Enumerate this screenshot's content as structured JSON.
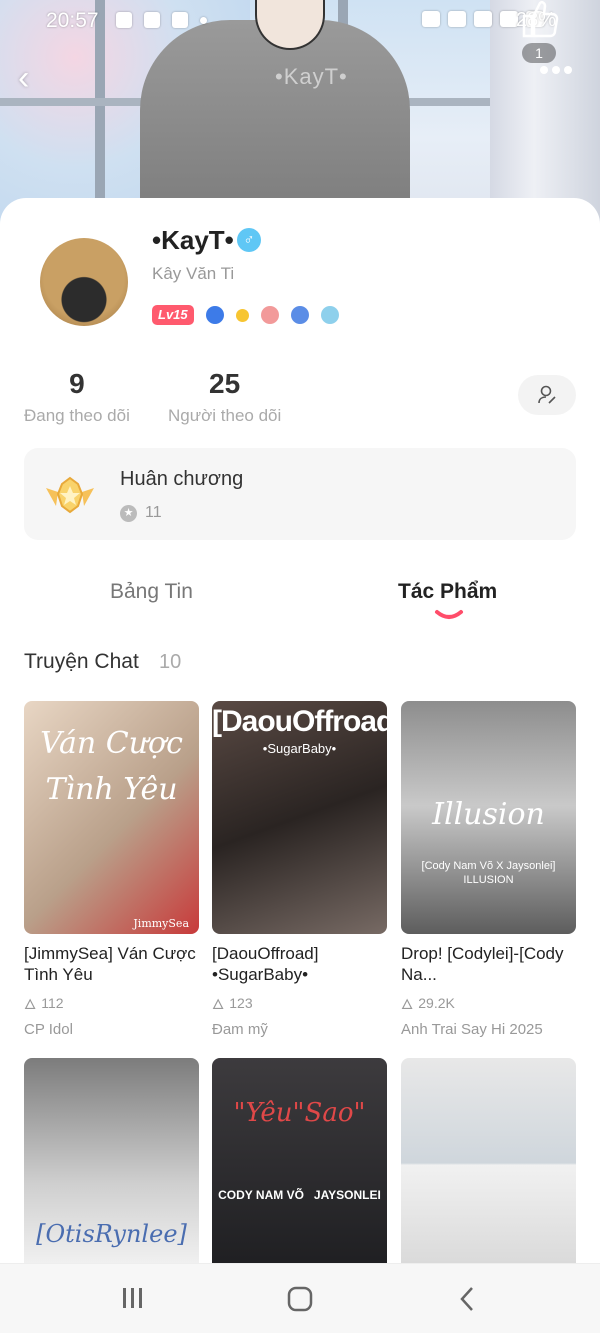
{
  "status_bar": {
    "time": "20:57",
    "battery": "28%"
  },
  "hero": {
    "shirt_text": "•KayT•",
    "like_count": "1"
  },
  "profile": {
    "nickname": "•KayT•",
    "gender_symbol": "♂",
    "real_name": "Kây Văn Ti",
    "level": "Lv15"
  },
  "stats": {
    "following_count": "9",
    "following_label": "Đang theo dõi",
    "followers_count": "25",
    "followers_label": "Người theo dõi"
  },
  "medals": {
    "title": "Huân chương",
    "count": "11"
  },
  "tabs": {
    "feed": "Bảng Tin",
    "works": "Tác Phẩm"
  },
  "section": {
    "title": "Truyện Chat",
    "count": "10"
  },
  "stories": [
    {
      "cover_text": "Ván Cược Tình Yêu",
      "cover_sub": "JimmySea",
      "title": "[JimmySea] Ván Cược Tình Yêu",
      "views": "112",
      "category": "CP Idol"
    },
    {
      "cover_text": "[DaouOffroad]",
      "cover_sub": "•SugarBaby•",
      "title": "[DaouOffroad] •SugarBaby•",
      "views": "123",
      "category": "Đam mỹ"
    },
    {
      "cover_text": "Illusion",
      "cover_sub": "[Cody Nam Võ X Jaysonlei] ILLUSION",
      "title": "Drop! [Codylei]-[Cody Na...",
      "views": "29.2K",
      "category": "Anh Trai Say Hi 2025"
    },
    {
      "cover_text": "[OtisRynlee]",
      "cover_sub": "",
      "title": "",
      "views": "",
      "category": ""
    },
    {
      "cover_text": "\"Yêu\"Sao\"",
      "cover_sub": "CODY NAM VÕ   JAYSONLEI",
      "title": "",
      "views": "",
      "category": ""
    },
    {
      "cover_text": "",
      "cover_sub": "",
      "title": "",
      "views": "",
      "category": ""
    }
  ],
  "colors": {
    "accent": "#ff4d6a",
    "level_badge": "#ff5a6e",
    "gender": "#5fc7f5"
  }
}
